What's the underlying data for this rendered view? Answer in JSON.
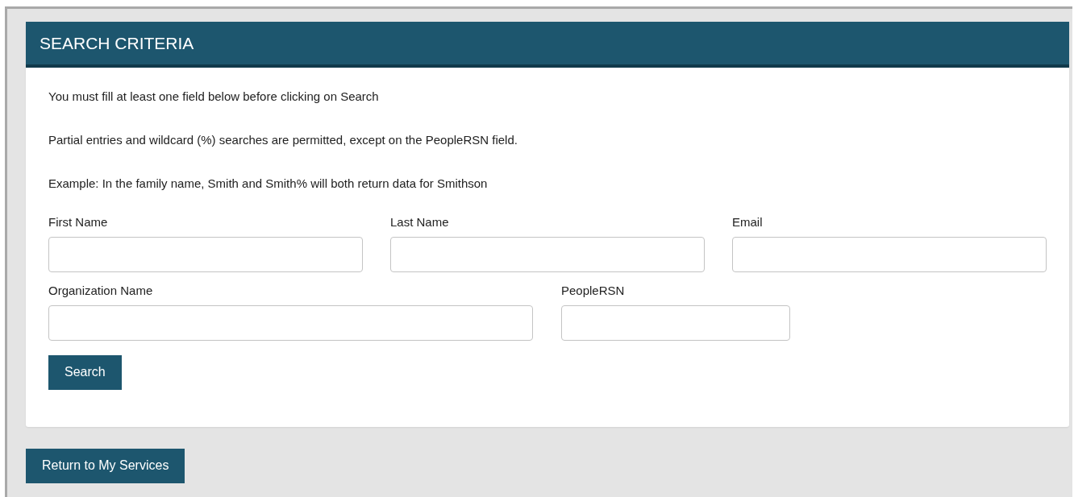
{
  "panel": {
    "title": "SEARCH CRITERIA",
    "instructions": [
      "You must fill at least one field below before clicking on Search",
      "Partial entries and wildcard (%) searches are permitted, except on the PeopleRSN field.",
      "Example: In the family name, Smith and Smith% will both return data for Smithson"
    ],
    "field_rows": [
      [
        {
          "label": "First Name"
        },
        {
          "label": "Last Name"
        },
        {
          "label": "Email"
        }
      ],
      [
        {
          "label": "Organization Name"
        },
        {
          "label": "PeopleRSN"
        }
      ]
    ],
    "search_button": "Search"
  },
  "return_button": "Return to My Services"
}
